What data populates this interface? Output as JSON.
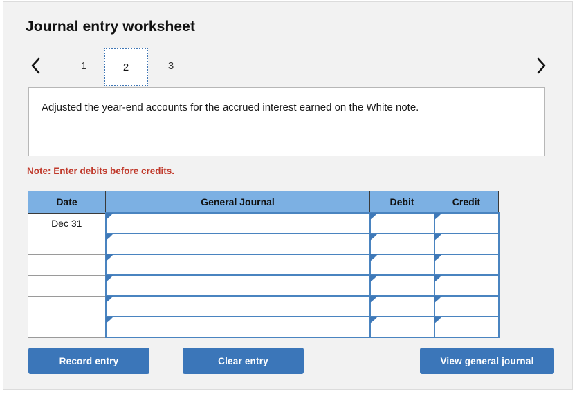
{
  "header": {
    "title": "Journal entry worksheet"
  },
  "tabs": {
    "prev_icon": "chevron-left-icon",
    "next_icon": "chevron-right-icon",
    "items": [
      {
        "label": "1",
        "selected": false
      },
      {
        "label": "2",
        "selected": true
      },
      {
        "label": "3",
        "selected": false
      }
    ]
  },
  "description": {
    "text": "Adjusted the year-end accounts for the accrued interest earned on the White note."
  },
  "note": {
    "text": "Note: Enter debits before credits."
  },
  "journal": {
    "columns": [
      {
        "key": "date",
        "label": "Date"
      },
      {
        "key": "general_journal",
        "label": "General Journal"
      },
      {
        "key": "debit",
        "label": "Debit"
      },
      {
        "key": "credit",
        "label": "Credit"
      }
    ],
    "rows": [
      {
        "date": "Dec 31",
        "general_journal": "",
        "debit": "",
        "credit": ""
      },
      {
        "date": "",
        "general_journal": "",
        "debit": "",
        "credit": ""
      },
      {
        "date": "",
        "general_journal": "",
        "debit": "",
        "credit": ""
      },
      {
        "date": "",
        "general_journal": "",
        "debit": "",
        "credit": ""
      },
      {
        "date": "",
        "general_journal": "",
        "debit": "",
        "credit": ""
      },
      {
        "date": "",
        "general_journal": "",
        "debit": "",
        "credit": ""
      }
    ]
  },
  "buttons": {
    "record": "Record entry",
    "clear": "Clear entry",
    "view": "View general journal"
  },
  "colors": {
    "button_blue": "#3b76b9",
    "header_blue": "#7cb0e3",
    "cell_border_blue": "#4a84c0",
    "note_red": "#c0392b",
    "page_background": "#f2f2f2"
  }
}
